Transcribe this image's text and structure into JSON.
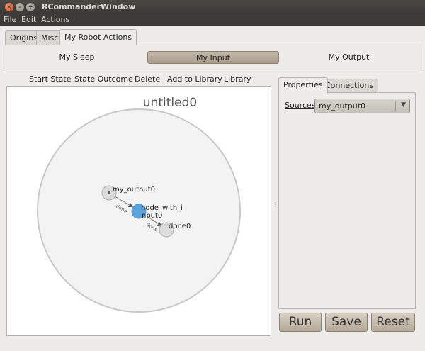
{
  "window": {
    "title": "RCommanderWindow"
  },
  "menu": {
    "file": "File",
    "edit": "Edit",
    "actions": "Actions"
  },
  "top_tabs": {
    "origins": "Origins",
    "misc": "Misc",
    "robot_actions": "My Robot Actions"
  },
  "actions": {
    "sleep": "My Sleep",
    "input": "My Input",
    "output": "My Output",
    "selected": "My Input"
  },
  "toolbar": {
    "start_state": "Start State",
    "state_outcome": "State Outcome",
    "delete": "Delete",
    "add_to_library": "Add to Library",
    "library": "Library"
  },
  "graph": {
    "title": "untitled0",
    "nodes": [
      {
        "name": "my_output0",
        "line2": ""
      },
      {
        "name": "node_with_i",
        "line2": "nput0"
      },
      {
        "name": "done0",
        "line2": ""
      }
    ],
    "edges": [
      {
        "label": "done"
      },
      {
        "label": "done"
      }
    ],
    "colors": {
      "selected_node": "#5ba3dd",
      "node": "#dcdcdc",
      "circle": "#f3f3f3"
    }
  },
  "side_tabs": {
    "properties": "Properties",
    "connections": "Connections"
  },
  "properties": {
    "sources_label": "Sources",
    "sources_value": "my_output0"
  },
  "buttons": {
    "run": "Run",
    "save": "Save",
    "reset": "Reset"
  }
}
